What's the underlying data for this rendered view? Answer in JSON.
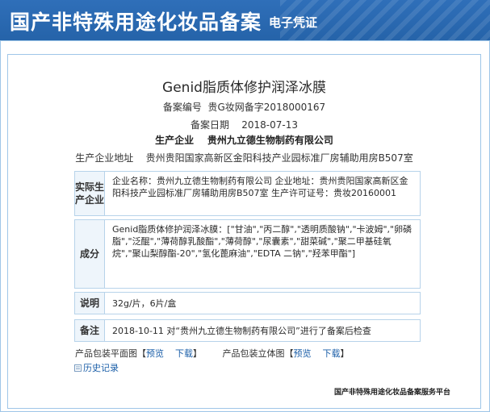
{
  "header": {
    "title": "国产非特殊用途化妆品备案",
    "subtitle": "电子凭证"
  },
  "product": {
    "name": "Genid脂质体修护润泽冰膜",
    "reg_no_label": "备案编号",
    "reg_no": "贵G妆网备字2018000167",
    "reg_date_label": "备案日期",
    "reg_date": "2018-07-13",
    "manufacturer_label": "生产企业",
    "manufacturer": "贵州九立德生物制药有限公司",
    "mfr_address_label": "生产企业地址",
    "mfr_address": "贵州贵阳国家高新区金阳科技产业园标准厂房辅助用房B507室"
  },
  "sections": {
    "actual_producer": {
      "label": "实际生产企业",
      "text": "企业名称：贵州九立德生物制药有限公司    企业地址：贵州贵阳国家高新区金阳科技产业园标准厂房辅助用房B507室    生产许可证号：贵妆20160001"
    },
    "ingredients": {
      "label": "成分",
      "text": "Genid脂质体修护润泽冰膜：[\"甘油\",\"丙二醇\",\"透明质酸钠\",\"卡波姆\",\"卵磷脂\",\"泛醌\",\"薄荷醇乳酸酯\",\"薄荷醇\",\"尿囊素\",\"甜菜碱\",\"聚二甲基硅氧烷\",\"聚山梨醇酯-20\",\"氢化蓖麻油\",\"EDTA 二钠\",\"羟苯甲酯\"]"
    },
    "description": {
      "label": "说明",
      "text": "32g/片，6片/盒"
    },
    "remark": {
      "label": "备注",
      "text": "2018-10-11 对“贵州九立德生物制药有限公司”进行了备案后检查"
    }
  },
  "links": {
    "flat_label": "产品包装平面图",
    "stereo_label": "产品包装立体图",
    "preview": "预览",
    "download": "下载",
    "bracket_open": "【",
    "bracket_close": "】",
    "history": "历史记录"
  },
  "footer": {
    "text": "国产非特殊用途化妆品备案服务平台"
  },
  "colors": {
    "header_blue": "#2f6fb9",
    "border_blue": "#9fc6e8",
    "link_blue": "#1a5ea8"
  }
}
